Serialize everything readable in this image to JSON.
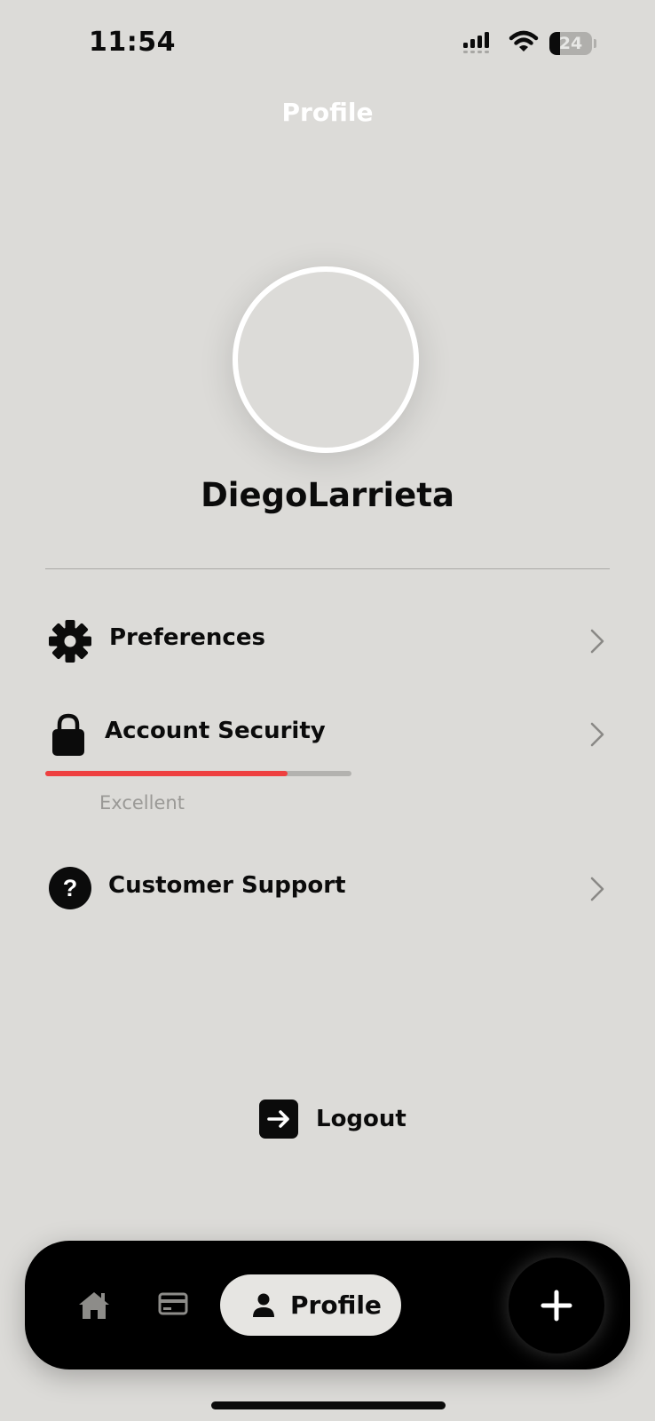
{
  "status_bar": {
    "time": "11:54",
    "battery_level": "24",
    "icons": [
      "signal-icon",
      "wifi-icon",
      "battery-icon"
    ]
  },
  "header": {
    "title": "Profile"
  },
  "profile": {
    "username": "DiegoLarrieta"
  },
  "menu": {
    "preferences": {
      "label": "Preferences",
      "icon": "gear-icon"
    },
    "account_security": {
      "label": "Account Security",
      "icon": "lock-icon",
      "strength_fraction": 0.79,
      "strength_label": "Excellent",
      "strength_color": "#ee4040"
    },
    "customer_support": {
      "label": "Customer Support",
      "icon": "question-circle-icon"
    }
  },
  "logout": {
    "label": "Logout",
    "icon": "arrow-right-icon"
  },
  "tab_bar": {
    "tabs": [
      {
        "icon": "home-icon",
        "active": false
      },
      {
        "icon": "card-icon",
        "active": false
      },
      {
        "icon": "person-icon",
        "label": "Profile",
        "active": true
      }
    ],
    "fab_icon": "plus-icon"
  },
  "colors": {
    "background": "#dcdbd8",
    "accent_red": "#ee4040",
    "tab_bar": "#000000",
    "active_tab": "#e6e5e2"
  }
}
